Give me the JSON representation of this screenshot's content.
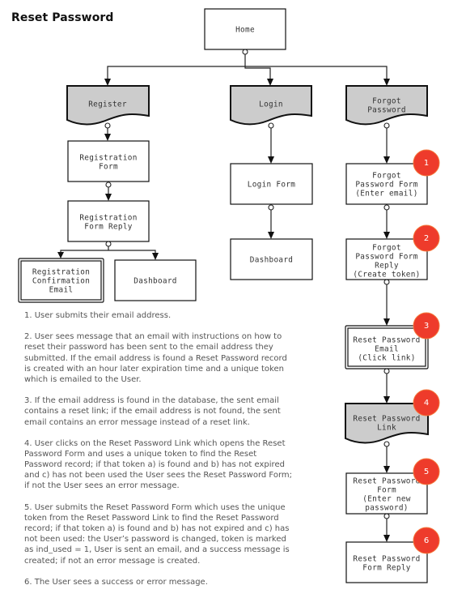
{
  "title": "Reset Password",
  "diagram": {
    "home": {
      "lines": [
        "Home"
      ]
    },
    "register": {
      "lines": [
        "Register"
      ]
    },
    "login": {
      "lines": [
        "Login"
      ]
    },
    "forgot_password": {
      "lines": [
        "Forgot",
        "Password"
      ]
    },
    "registration_form": {
      "lines": [
        "Registration",
        "Form"
      ]
    },
    "registration_form_reply": {
      "lines": [
        "Registration",
        "Form Reply"
      ]
    },
    "registration_confirmation_email": {
      "lines": [
        "Registration",
        "Confirmation",
        "Email"
      ]
    },
    "register_dashboard": {
      "lines": [
        "Dashboard"
      ]
    },
    "login_form": {
      "lines": [
        "Login Form"
      ]
    },
    "login_dashboard": {
      "lines": [
        "Dashboard"
      ]
    },
    "forgot_password_form": {
      "lines": [
        "Forgot",
        "Password Form",
        "(Enter email)"
      ]
    },
    "forgot_password_form_reply": {
      "lines": [
        "Forgot",
        "Password Form",
        "Reply",
        "(Create token)"
      ]
    },
    "reset_password_email": {
      "lines": [
        "Reset Password",
        "Email",
        "(Click link)"
      ]
    },
    "reset_password_link": {
      "lines": [
        "Reset Password",
        "Link"
      ]
    },
    "reset_password_form": {
      "lines": [
        "Reset Password",
        "Form",
        "(Enter new",
        "password)"
      ]
    },
    "reset_password_form_reply": {
      "lines": [
        "Reset Password",
        "Form Reply"
      ]
    },
    "badges": [
      "1",
      "2",
      "3",
      "4",
      "5",
      "6"
    ],
    "colors": {
      "badge": "#ee3b2b",
      "document_fill": "#cccccc"
    }
  },
  "notes": [
    {
      "lines": [
        "1. User submits their email address."
      ]
    },
    {
      "lines": [
        "2. User sees message that an email with instructions on how to",
        "reset their password has been sent to the email address they",
        "submitted. If the email address is found a Reset Password record",
        "is created with an hour later expiration time and a unique token",
        "which is emailed to the User."
      ]
    },
    {
      "lines": [
        "3. If the email address is found in the database, the sent email",
        "contains a reset link; if the email address is not found, the sent",
        "email contains an error message instead of a reset link."
      ]
    },
    {
      "lines": [
        "4. User clicks on the Reset Password Link which opens the Reset",
        "Password Form and uses a unique token to find the Reset",
        "Password record; if that token a) is found and b) has not expired",
        "and c) has not been used the User sees the Reset Password Form;",
        "if not the User sees an error message."
      ]
    },
    {
      "lines": [
        "5. User submits the Reset Password Form which uses the unique",
        "token from the Reset Password Link to find the Reset Password",
        "record; if that token a) is found and b) has not expired and c) has",
        "not been used: the User’s password is changed, token is marked",
        "as ind_used = 1, User is sent an email, and a success message is",
        "created; if not an error message is created."
      ]
    },
    {
      "lines": [
        "6. The User sees a success or error message."
      ]
    }
  ]
}
